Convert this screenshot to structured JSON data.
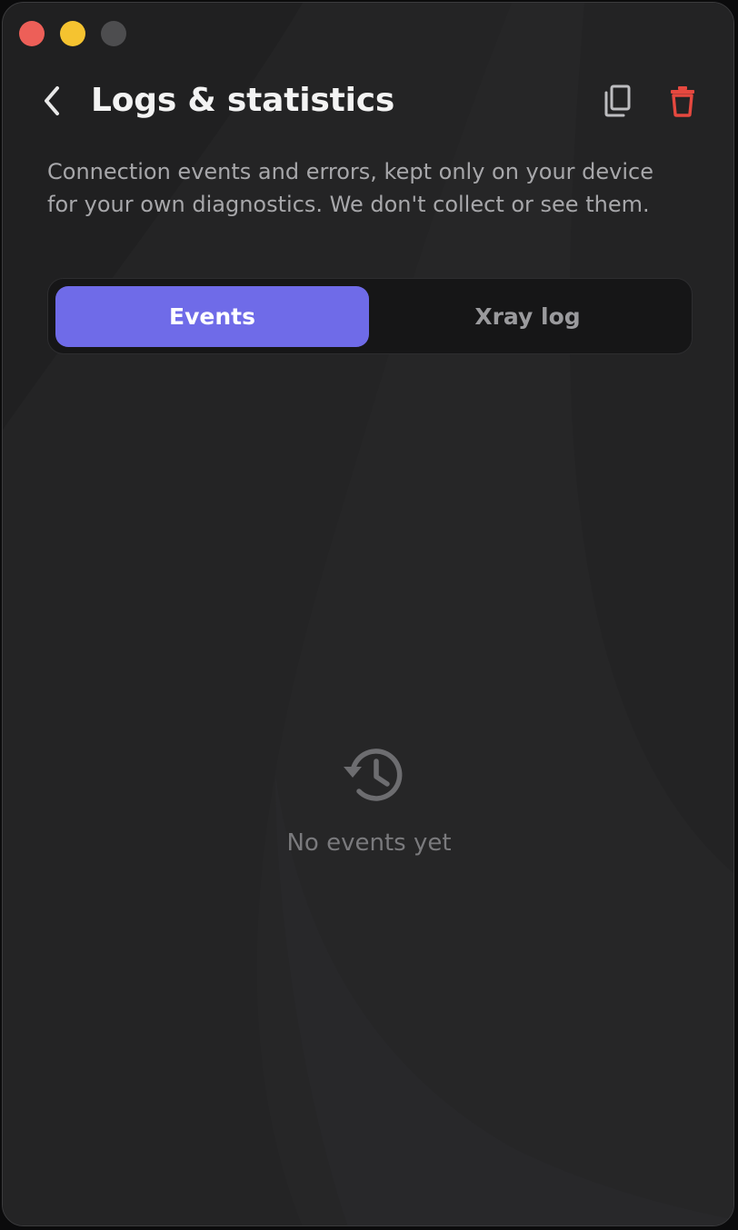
{
  "window": {
    "controls": [
      "close",
      "minimize",
      "zoom"
    ]
  },
  "header": {
    "back_icon": "chevron-left-icon",
    "title": "Logs & statistics",
    "copy_icon": "copy-icon",
    "delete_icon": "trash-icon"
  },
  "description": "Connection events and errors, kept only on your device for your own diagnostics. We don't collect or see them.",
  "tabs": [
    {
      "label": "Events",
      "selected": true
    },
    {
      "label": "Xray log",
      "selected": false
    }
  ],
  "empty_state": {
    "icon": "history-icon",
    "text": "No events yet"
  },
  "colors": {
    "accent": "#6f6be8",
    "danger": "#e5483f",
    "background": "#202021"
  }
}
